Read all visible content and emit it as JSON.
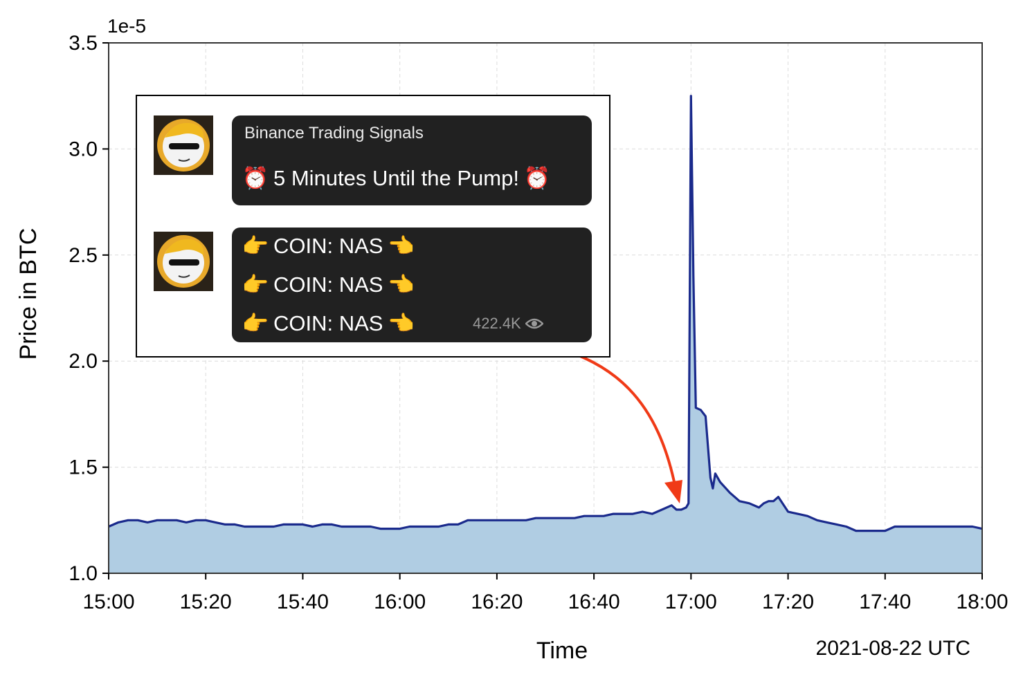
{
  "chart_data": {
    "type": "area",
    "ylabel": "Price  in BTC",
    "xlabel": "Time",
    "y_scale_label": "1e-5",
    "date_note": "2021-08-22 UTC",
    "xlim": [
      0,
      180
    ],
    "ylim": [
      1.0,
      3.5
    ],
    "grid": true,
    "x_ticks": [
      {
        "value": 0,
        "label": "15:00"
      },
      {
        "value": 20,
        "label": "15:20"
      },
      {
        "value": 40,
        "label": "15:40"
      },
      {
        "value": 60,
        "label": "16:00"
      },
      {
        "value": 80,
        "label": "16:20"
      },
      {
        "value": 100,
        "label": "16:40"
      },
      {
        "value": 120,
        "label": "17:00"
      },
      {
        "value": 140,
        "label": "17:20"
      },
      {
        "value": 160,
        "label": "17:40"
      },
      {
        "value": 180,
        "label": "18:00"
      }
    ],
    "y_ticks": [
      {
        "value": 1.0,
        "label": "1.0"
      },
      {
        "value": 1.5,
        "label": "1.5"
      },
      {
        "value": 2.0,
        "label": "2.0"
      },
      {
        "value": 2.5,
        "label": "2.5"
      },
      {
        "value": 3.0,
        "label": "3.0"
      },
      {
        "value": 3.5,
        "label": "3.5"
      }
    ],
    "series": [
      {
        "line_color": "#1a2a8c",
        "fill_color": "#b0cde3",
        "x": [
          0,
          2,
          4,
          6,
          8,
          10,
          12,
          14,
          16,
          18,
          20,
          22,
          24,
          26,
          28,
          30,
          32,
          34,
          36,
          38,
          40,
          42,
          44,
          46,
          48,
          50,
          52,
          54,
          56,
          58,
          60,
          62,
          64,
          66,
          68,
          70,
          72,
          74,
          76,
          78,
          80,
          82,
          84,
          86,
          88,
          90,
          92,
          94,
          96,
          98,
          100,
          102,
          104,
          106,
          108,
          110,
          112,
          114,
          116,
          117,
          118,
          119,
          119.5,
          120,
          120.5,
          121,
          122,
          123,
          124,
          124.5,
          125,
          126,
          128,
          130,
          132,
          134,
          135,
          136,
          137,
          138,
          140,
          142,
          144,
          146,
          148,
          150,
          152,
          154,
          156,
          158,
          160,
          162,
          164,
          166,
          168,
          170,
          172,
          174,
          176,
          178,
          180
        ],
        "y": [
          1.22,
          1.24,
          1.25,
          1.25,
          1.24,
          1.25,
          1.25,
          1.25,
          1.24,
          1.25,
          1.25,
          1.24,
          1.23,
          1.23,
          1.22,
          1.22,
          1.22,
          1.22,
          1.23,
          1.23,
          1.23,
          1.22,
          1.23,
          1.23,
          1.22,
          1.22,
          1.22,
          1.22,
          1.21,
          1.21,
          1.21,
          1.22,
          1.22,
          1.22,
          1.22,
          1.23,
          1.23,
          1.25,
          1.25,
          1.25,
          1.25,
          1.25,
          1.25,
          1.25,
          1.26,
          1.26,
          1.26,
          1.26,
          1.26,
          1.27,
          1.27,
          1.27,
          1.28,
          1.28,
          1.28,
          1.29,
          1.28,
          1.3,
          1.32,
          1.3,
          1.3,
          1.31,
          1.33,
          3.25,
          2.4,
          1.78,
          1.77,
          1.74,
          1.45,
          1.4,
          1.47,
          1.43,
          1.38,
          1.34,
          1.33,
          1.31,
          1.33,
          1.34,
          1.34,
          1.36,
          1.29,
          1.28,
          1.27,
          1.25,
          1.24,
          1.23,
          1.22,
          1.2,
          1.2,
          1.2,
          1.2,
          1.22,
          1.22,
          1.22,
          1.22,
          1.22,
          1.22,
          1.22,
          1.22,
          1.22,
          1.21
        ]
      }
    ]
  },
  "inset": {
    "messages": [
      {
        "sender": "Binance Trading Signals",
        "lines": [
          "5 Minutes Until the Pump!"
        ],
        "prefix_emoji": "⏰",
        "suffix_emoji": "⏰"
      },
      {
        "lines": [
          "COIN: NAS",
          "COIN: NAS",
          "COIN: NAS"
        ],
        "prefix_emoji": "👉",
        "suffix_emoji": "👈",
        "views": "422.4K"
      }
    ],
    "arrow_color": "#f03a17"
  }
}
